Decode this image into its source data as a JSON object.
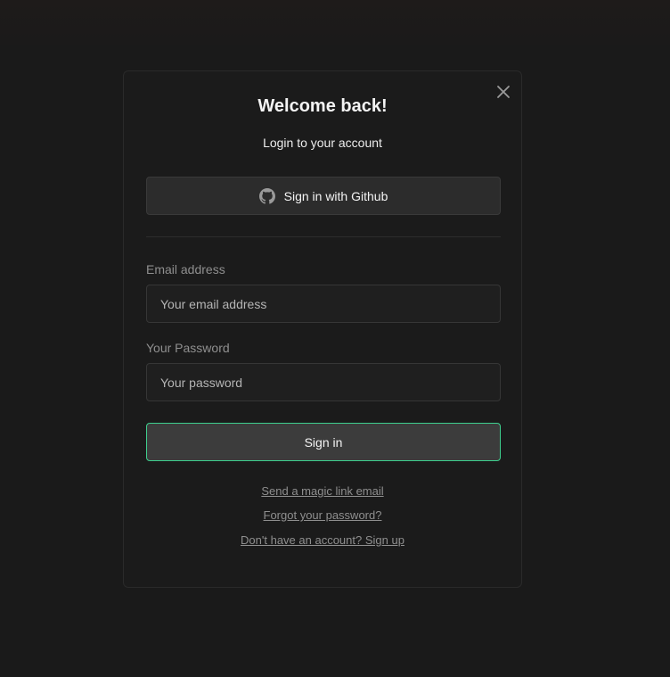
{
  "modal": {
    "title": "Welcome back!",
    "subtitle": "Login to your account",
    "close_icon": "close-icon"
  },
  "github": {
    "label": "Sign in with Github",
    "icon": "github-icon"
  },
  "email": {
    "label": "Email address",
    "value": "",
    "placeholder": "Your email address"
  },
  "password": {
    "label": "Your Password",
    "value": "",
    "placeholder": "Your password"
  },
  "submit": {
    "label": "Sign in",
    "accent": "#3ecf8e"
  },
  "links": {
    "magic_link": "Send a magic link email",
    "forgot_password": "Forgot your password?",
    "sign_up": "Don't have an account? Sign up"
  },
  "colors": {
    "background": "#1a1a1a",
    "panel": "#1b1b1b",
    "accent": "#3ecf8e"
  }
}
